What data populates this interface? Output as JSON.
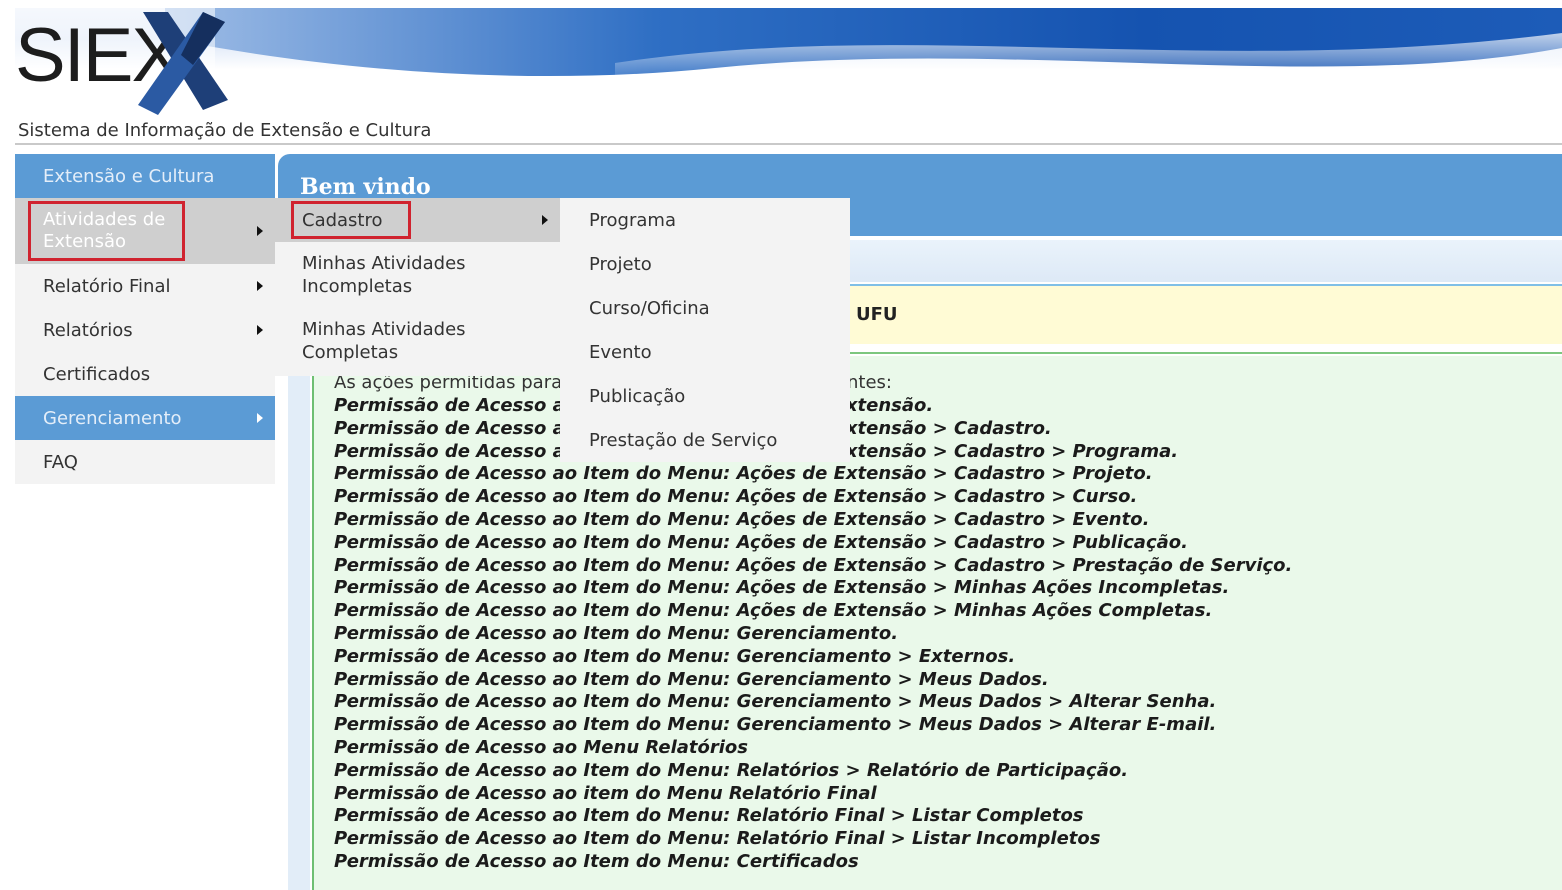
{
  "header": {
    "logo_text": "SIEX",
    "subtitle": "Sistema de Informação de Extensão e Cultura"
  },
  "sidebar": {
    "items": [
      {
        "label": "Extensão e Cultura"
      },
      {
        "label": "Atividades de Extensão"
      },
      {
        "label": "Relatório Final"
      },
      {
        "label": "Relatórios"
      },
      {
        "label": "Certificados"
      },
      {
        "label": "Gerenciamento"
      },
      {
        "label": "FAQ"
      }
    ]
  },
  "submenu": {
    "items": [
      {
        "label": "Cadastro"
      },
      {
        "label": "Minhas Atividades Incompletas"
      },
      {
        "label": "Minhas Atividades Completas"
      }
    ]
  },
  "cadastro_menu": {
    "items": [
      {
        "label": "Programa"
      },
      {
        "label": "Projeto"
      },
      {
        "label": "Curso/Oficina"
      },
      {
        "label": "Evento"
      },
      {
        "label": "Publicação"
      },
      {
        "label": "Prestação de Serviço"
      }
    ]
  },
  "main": {
    "title": "Bem vindo",
    "info_text": "UFU",
    "permissions_intro": "As ações permitidas para",
    "permissions_intro_tail": "intes:",
    "permissions": [
      "Permissão de Acesso ao Item do Menu: Ações de Extensão.",
      "Permissão de Acesso ao Item do Menu: Ações de Extensão > Cadastro.",
      "Permissão de Acesso ao Item do Menu: Ações de Extensão > Cadastro > Programa.",
      "Permissão de Acesso ao Item do Menu: Ações de Extensão > Cadastro > Projeto.",
      "Permissão de Acesso ao Item do Menu: Ações de Extensão > Cadastro > Curso.",
      "Permissão de Acesso ao Item do Menu: Ações de Extensão > Cadastro > Evento.",
      "Permissão de Acesso ao Item do Menu: Ações de Extensão > Cadastro > Publicação.",
      "Permissão de Acesso ao Item do Menu: Ações de Extensão > Cadastro > Prestação de Serviço.",
      "Permissão de Acesso ao Item do Menu: Ações de Extensão > Minhas Ações Incompletas.",
      "Permissão de Acesso ao Item do Menu: Ações de Extensão > Minhas Ações Completas.",
      "Permissão de Acesso ao Item do Menu: Gerenciamento.",
      "Permissão de Acesso ao Item do Menu: Gerenciamento > Externos.",
      "Permissão de Acesso ao Item do Menu: Gerenciamento > Meus Dados.",
      "Permissão de Acesso ao Item do Menu: Gerenciamento > Meus Dados > Alterar Senha.",
      "Permissão de Acesso ao Item do Menu: Gerenciamento > Meus Dados > Alterar E-mail.",
      "Permissão de Acesso ao Menu Relatórios",
      "Permissão de Acesso ao Item do Menu: Relatórios > Relatório de Participação.",
      "Permissão de Acesso ao item do Menu Relatório Final",
      "Permissão de Acesso ao Item do Menu: Relatório Final > Listar Completos",
      "Permissão de Acesso ao Item do Menu: Relatório Final > Listar Incompletos",
      "Permissão de Acesso ao Item do Menu: Certificados"
    ]
  },
  "colors": {
    "menu_blue": "#5b9bd5",
    "highlight_red": "#d0232f",
    "permission_bg": "#eaf9ea",
    "info_bg": "#fffbd5"
  }
}
